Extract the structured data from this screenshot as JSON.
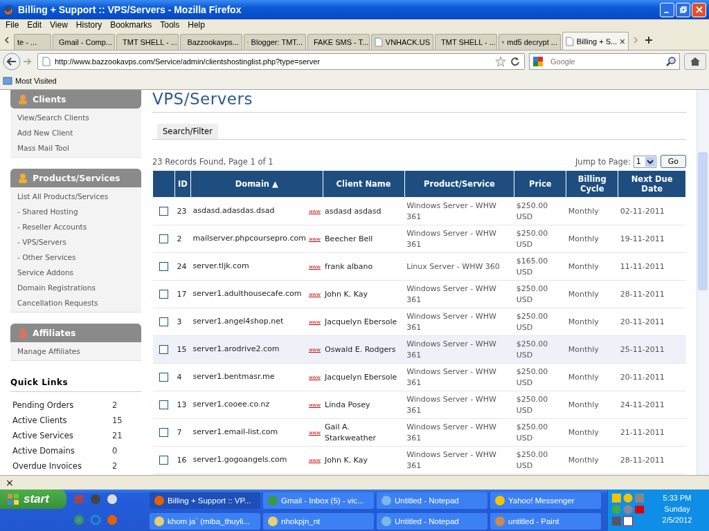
{
  "window": {
    "title": "Billing + Support :: VPS/Servers - Mozilla Firefox"
  },
  "menu": [
    "File",
    "Edit",
    "View",
    "History",
    "Bookmarks",
    "Tools",
    "Help"
  ],
  "tabs": [
    {
      "label": "te - ...",
      "selected": false
    },
    {
      "label": "Gmail - Comp...",
      "selected": false
    },
    {
      "label": "TMT SHELL - ...",
      "selected": false
    },
    {
      "label": "Bazzookavps...",
      "selected": false
    },
    {
      "label": "Blogger: TMT...",
      "selected": false
    },
    {
      "label": "FAKE SMS - T...",
      "selected": false
    },
    {
      "label": "VNHACK.US",
      "selected": false
    },
    {
      "label": "TMT SHELL - ...",
      "selected": false
    },
    {
      "label": "md5 decrypt ...",
      "selected": false
    },
    {
      "label": "Billing + S...",
      "selected": true
    }
  ],
  "address": {
    "value": "http://www.bazzookavps.com/Service/admin/clientshostinglist.php?type=server"
  },
  "search": {
    "placeholder": "Google"
  },
  "bookmarks": [
    "Most Visited"
  ],
  "sidebar": [
    {
      "title": "Clients",
      "items": [
        "View/Search Clients",
        "Add New Client",
        "Mass Mail Tool"
      ]
    },
    {
      "title": "Products/Services",
      "items": [
        "List All Products/Services",
        "- Shared Hosting",
        "- Reseller Accounts",
        "- VPS/Servers",
        "- Other Services",
        "Service Addons",
        "Domain Registrations",
        "Cancellation Requests"
      ]
    },
    {
      "title": "Affiliates",
      "items": [
        "Manage Affiliates"
      ]
    }
  ],
  "quick_links": {
    "title": "Quick Links",
    "items": [
      {
        "label": "Pending Orders",
        "count": "2"
      },
      {
        "label": "Active Clients",
        "count": "15"
      },
      {
        "label": "Active Services",
        "count": "21"
      },
      {
        "label": "Active Domains",
        "count": "0"
      },
      {
        "label": "Overdue Invoices",
        "count": "2"
      }
    ]
  },
  "page": {
    "title": "VPS/Servers",
    "filter_tab": "Search/Filter",
    "records": "23 Records Found, Page 1 of 1",
    "jump_label": "Jump to Page:",
    "jump_value": "1",
    "go": "Go"
  },
  "table": {
    "columns": [
      "ID",
      "Domain ▲",
      "Client Name",
      "Product/Service",
      "Price",
      "Billing Cycle",
      "Next Due Date"
    ],
    "rows": [
      {
        "checked": false,
        "selected": false,
        "id": "23",
        "domain": "asdasd.adasdas.dsad",
        "link": "www",
        "client": "asdasd asdasd",
        "product": "Windows Server - WHW 361",
        "price": "$250.00 USD",
        "cycle": "Monthly",
        "due": "02-11-2011"
      },
      {
        "checked": false,
        "selected": false,
        "id": "2",
        "domain": "mailserver.phpcoursepro.com",
        "link": "www",
        "client": "Beecher Bell",
        "product": "Windows Server - WHW 361",
        "price": "$250.00 USD",
        "cycle": "Monthly",
        "due": "19-11-2011"
      },
      {
        "checked": false,
        "selected": false,
        "id": "24",
        "domain": "server.tljk.com",
        "link": "www",
        "client": "frank albano",
        "product": "Linux Server - WHW 360",
        "price": "$165.00 USD",
        "cycle": "Monthly",
        "due": "11-11-2011"
      },
      {
        "checked": false,
        "selected": false,
        "id": "17",
        "domain": "server1.adulthousecafe.com",
        "link": "www",
        "client": "John K. Kay",
        "product": "Windows Server - WHW 361",
        "price": "$250.00 USD",
        "cycle": "Monthly",
        "due": "28-11-2011"
      },
      {
        "checked": false,
        "selected": false,
        "id": "3",
        "domain": "server1.angel4shop.net",
        "link": "www",
        "client": "Jacquelyn Ebersole",
        "product": "Windows Server - WHW 361",
        "price": "$250.00 USD",
        "cycle": "Monthly",
        "due": "20-11-2011"
      },
      {
        "checked": false,
        "selected": true,
        "id": "15",
        "domain": "server1.arodrive2.com",
        "link": "www",
        "client": "Oswald E. Rodgers",
        "product": "Windows Server - WHW 361",
        "price": "$250.00 USD",
        "cycle": "Monthly",
        "due": "25-11-2011"
      },
      {
        "checked": false,
        "selected": false,
        "id": "4",
        "domain": "server1.bentmasr.me",
        "link": "www",
        "client": "Jacquelyn Ebersole",
        "product": "Windows Server - WHW 361",
        "price": "$250.00 USD",
        "cycle": "Monthly",
        "due": "20-11-2011"
      },
      {
        "checked": false,
        "selected": false,
        "id": "13",
        "domain": "server1.cooee.co.nz",
        "link": "www",
        "client": "Linda Posey",
        "product": "Windows Server - WHW 361",
        "price": "$250.00 USD",
        "cycle": "Monthly",
        "due": "24-11-2011"
      },
      {
        "checked": false,
        "selected": false,
        "id": "7",
        "domain": "server1.email-list.com",
        "link": "www",
        "client": "Gail A. Starkweather",
        "product": "Windows Server - WHW 361",
        "price": "$250.00 USD",
        "cycle": "Monthly",
        "due": "21-11-2011"
      },
      {
        "checked": false,
        "selected": false,
        "id": "16",
        "domain": "server1.gogoangels.com",
        "link": "www",
        "client": "John K. Kay",
        "product": "Windows Server - WHW 361",
        "price": "$250.00 USD",
        "cycle": "Monthly",
        "due": "28-11-2011"
      }
    ]
  },
  "findbar": {
    "close": "×"
  },
  "taskbar": {
    "start": "start",
    "tasks": [
      {
        "label": "Billing + Support :: VP...",
        "selected": true
      },
      {
        "label": "Gmail - Inbox (5) - vic...",
        "selected": false
      },
      {
        "label": "Untitled - Notepad",
        "selected": false
      },
      {
        "label": "Yahoo! Messenger",
        "selected": false
      },
      {
        "label": "khom ja` (miba_thuyli...",
        "selected": false
      },
      {
        "label": "nhokpjn_nt",
        "selected": false
      },
      {
        "label": "Untitled - Notepad",
        "selected": false
      },
      {
        "label": "untitled - Paint",
        "selected": false
      }
    ],
    "time": "5:33 PM",
    "day": "Sunday",
    "date": "2/5/2012"
  }
}
